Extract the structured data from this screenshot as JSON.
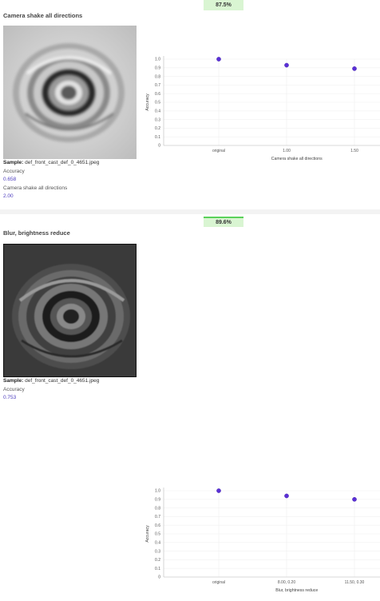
{
  "panels": [
    {
      "score_badge": "87.5%",
      "title": "Camera shake all directions",
      "sample_label": "Sample:",
      "sample_file": "def_front_cast_def_0_4651.jpeg",
      "accuracy_label": "Accuracy",
      "accuracy_value": "0.658",
      "param_label": "Camera shake all directions",
      "param_value": "2.00",
      "image": {
        "icon": "casting-part-photo",
        "style": "blurred"
      },
      "chart_data": {
        "type": "scatter",
        "categories": [
          "original",
          "1.00",
          "1.50"
        ],
        "values": [
          1.0,
          0.93,
          0.89
        ],
        "xlabel": "Camera shake all directions",
        "ylabel": "Accuracy",
        "ylim": [
          0,
          1
        ],
        "yticks": [
          "0",
          "0.1",
          "0.2",
          "0.3",
          "0.4",
          "0.5",
          "0.6",
          "0.7",
          "0.8",
          "0.9",
          "1.0"
        ],
        "point_color": "#5b2fd6",
        "grid": true
      }
    },
    {
      "score_badge": "89.6%",
      "title": "Blur, brightness reduce",
      "sample_label": "Sample:",
      "sample_file": "def_front_cast_def_0_4651.jpeg",
      "accuracy_label": "Accuracy",
      "accuracy_value": "0.753",
      "image": {
        "icon": "casting-part-photo",
        "style": "dark"
      },
      "chart_data": {
        "type": "scatter",
        "categories": [
          "original",
          "8.00, 0.20",
          "11.50, 0.30"
        ],
        "values": [
          1.0,
          0.94,
          0.9
        ],
        "xlabel": "Blur, brightness reduce",
        "ylabel": "Accuracy",
        "ylim": [
          0,
          1
        ],
        "yticks": [
          "0",
          "0.1",
          "0.2",
          "0.3",
          "0.4",
          "0.5",
          "0.6",
          "0.7",
          "0.8",
          "0.9",
          "1.0"
        ],
        "point_color": "#5b2fd6",
        "grid": true
      }
    }
  ]
}
